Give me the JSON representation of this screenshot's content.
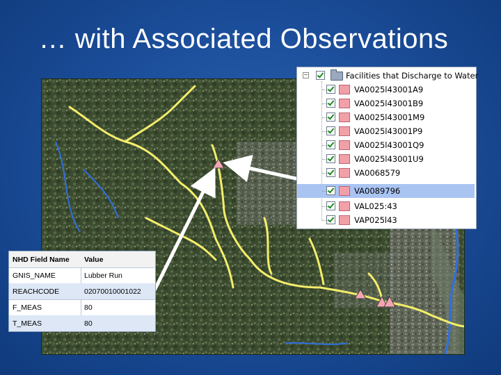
{
  "slide": {
    "title": "… with Associated Observations"
  },
  "layer_tree": {
    "root_label": "Facilities that Discharge to Water",
    "items": [
      {
        "label": "VA0025l43001A9",
        "checked": true,
        "selected": false
      },
      {
        "label": "VA0025l43001B9",
        "checked": true,
        "selected": false
      },
      {
        "label": "VA0025l43001M9",
        "checked": true,
        "selected": false
      },
      {
        "label": "VA0025l43001P9",
        "checked": true,
        "selected": false
      },
      {
        "label": "VA0025l43001Q9",
        "checked": true,
        "selected": false
      },
      {
        "label": "VA0025l43001U9",
        "checked": true,
        "selected": false
      },
      {
        "label": "VA0068579",
        "checked": true,
        "selected": false
      },
      {
        "label": "VA0089796",
        "checked": true,
        "selected": true
      },
      {
        "label": "VAL025:43",
        "checked": true,
        "selected": false
      },
      {
        "label": "VAP025l43",
        "checked": true,
        "selected": false
      }
    ]
  },
  "attribute_table": {
    "headers": {
      "field": "NHD Field Name",
      "value": "Value"
    },
    "rows": [
      {
        "field": "GNIS_NAME",
        "value": "Lubber Run"
      },
      {
        "field": "REACHCODE",
        "value": "02070010001022"
      },
      {
        "field": "F_MEAS",
        "value": "80"
      },
      {
        "field": "T_MEAS",
        "value": "80"
      }
    ]
  },
  "colors": {
    "stream_highlight": "#f4ee6a",
    "facility_marker": "#f3a6b0",
    "river": "#2f6fe0",
    "selection": "#aac4f2"
  }
}
